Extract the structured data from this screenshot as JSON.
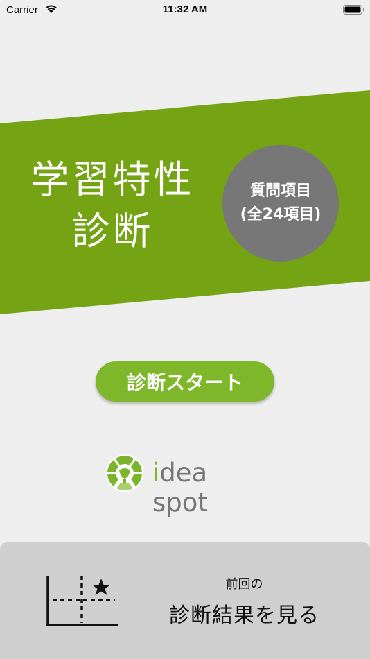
{
  "status_bar": {
    "carrier": "Carrier",
    "time": "11:32 AM",
    "wifi_icon": "wifi-icon",
    "battery_icon": "battery-icon"
  },
  "banner": {
    "title_line1": "学習特性",
    "title_line2": "診断",
    "color": "#74a314",
    "badge": {
      "line1": "質問項目",
      "line2": "(全24項目)",
      "color": "#777777"
    }
  },
  "start_button": {
    "label": "診断スタート",
    "color": "#7eb82a"
  },
  "logo": {
    "text_prefix": "i",
    "text_rest": "dea spot",
    "mark_icon": "idea-spot-logo-icon"
  },
  "footer": {
    "small_label": "前回の",
    "large_label": "診断結果を見る",
    "icon": "chart-star-icon"
  }
}
